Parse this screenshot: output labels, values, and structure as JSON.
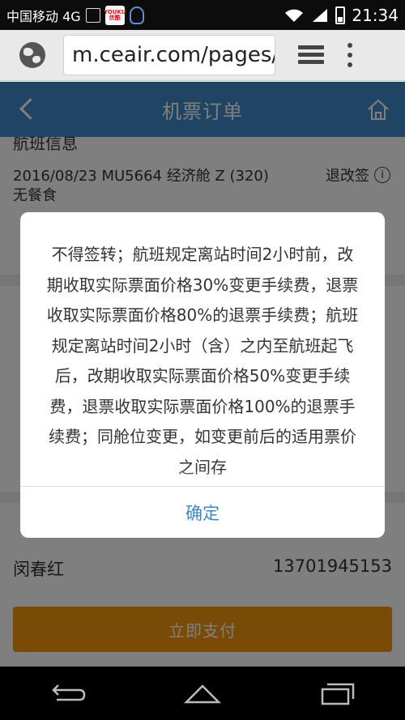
{
  "status_bar": {
    "carrier": "中国移动 4G",
    "youku_label": "YOUKU 优酷",
    "network": "4G",
    "time": "21:34"
  },
  "browser": {
    "url": "m.ceair.com/pages/c"
  },
  "header": {
    "title": "机票订单"
  },
  "flight_section": {
    "title_partial": "航班信息",
    "flight_line": "2016/08/23 MU5664 经济舱 Z (320)",
    "meal": "无餐食",
    "change_rules_label": "退改签",
    "info_glyph": "i"
  },
  "contact": {
    "name": "闵春红",
    "phone": "13701945153"
  },
  "pay_button": "立即支付",
  "modal": {
    "text": "不得签转；航班规定离站时间2小时前，改期收取实际票面价格30%变更手续费，退票收取实际票面价格80%的退票手续费；航班规定离站时间2小时（含）之内至航班起飞后，改期收取实际票面价格50%变更手续费，退票收取实际票面价格100%的退票手续费；同舱位变更，如变更前后的适用票价之间存",
    "confirm": "确定"
  },
  "colors": {
    "header_blue": "#3f88c8",
    "pay_orange": "#f3960f",
    "confirm_text": "#3f88c8"
  }
}
